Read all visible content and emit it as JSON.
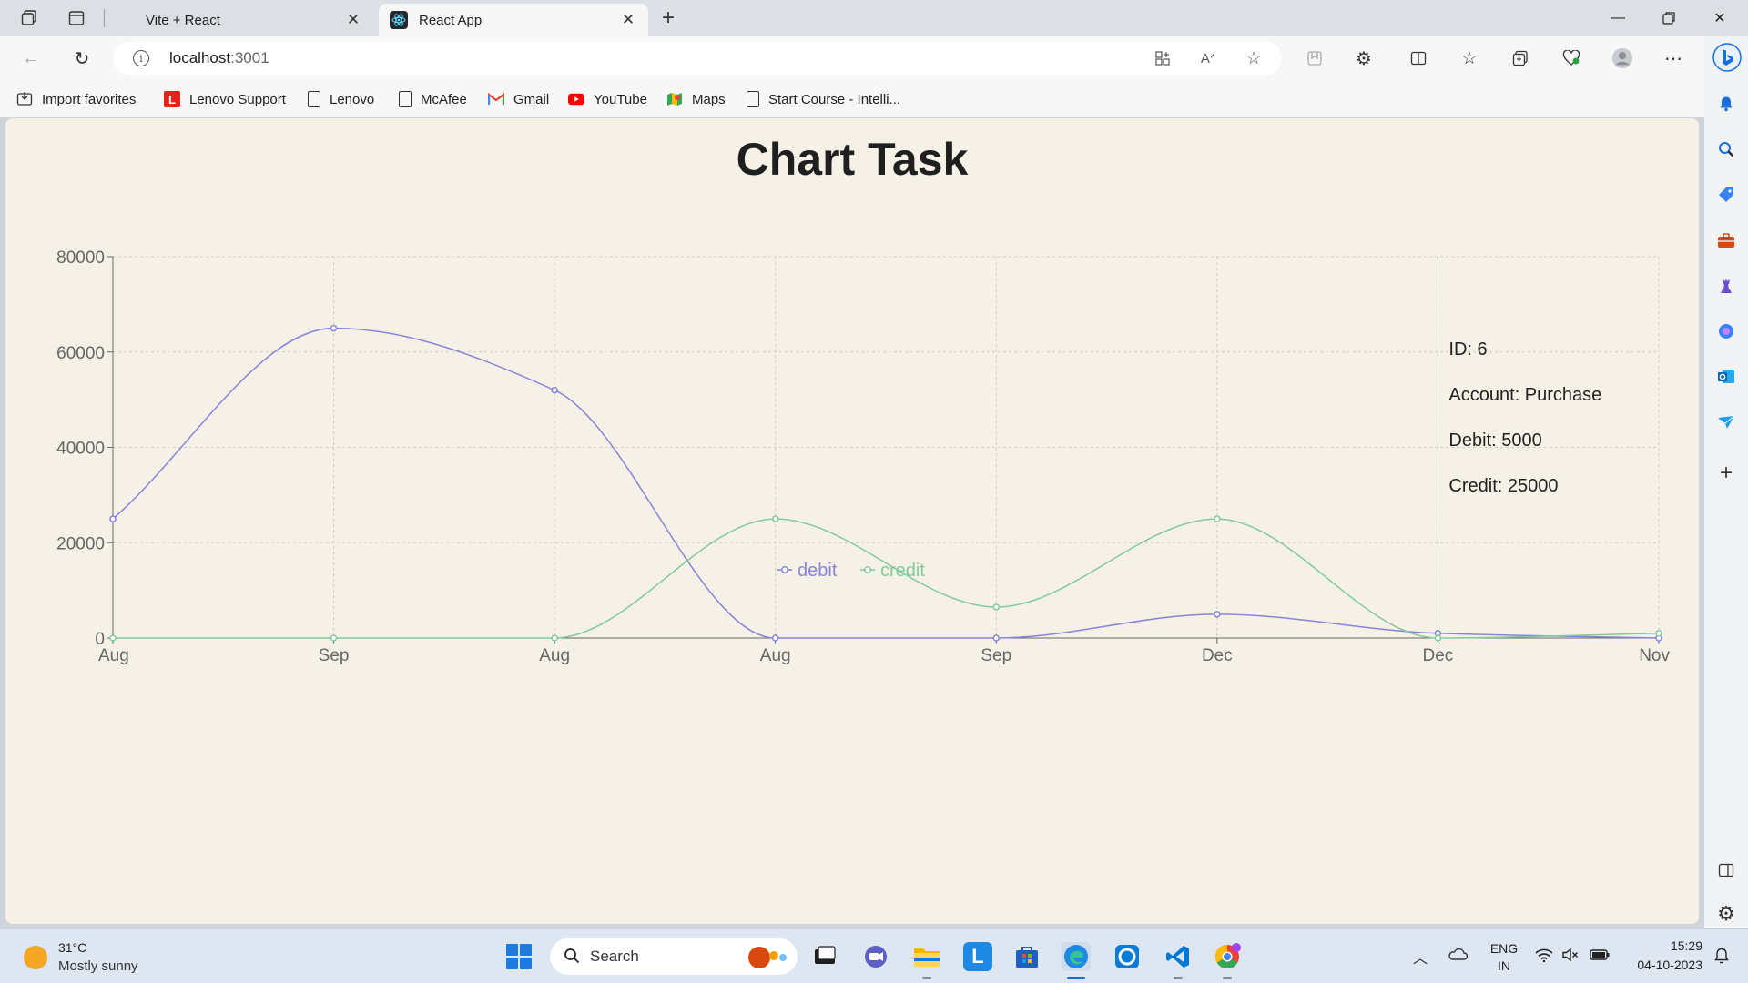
{
  "browser": {
    "tabs": [
      {
        "title": "Vite + React"
      },
      {
        "title": "React App",
        "active": true
      }
    ],
    "address": {
      "host": "localhost",
      "port": ":3001"
    },
    "favorites": [
      {
        "label": "Import favorites",
        "icon": "import-icon"
      },
      {
        "label": "Lenovo Support",
        "icon": "lenovo-l-icon"
      },
      {
        "label": "Lenovo",
        "icon": "document-icon"
      },
      {
        "label": "McAfee",
        "icon": "document-icon"
      },
      {
        "label": "Gmail",
        "icon": "gmail-icon"
      },
      {
        "label": "YouTube",
        "icon": "youtube-icon"
      },
      {
        "label": "Maps",
        "icon": "maps-icon"
      },
      {
        "label": "Start Course - Intelli...",
        "icon": "document-icon"
      }
    ]
  },
  "page": {
    "title": "Chart Task"
  },
  "chart_data": {
    "type": "line",
    "curve": "monotone",
    "categories": [
      "Aug",
      "Sep",
      "Aug",
      "Aug",
      "Sep",
      "Dec",
      "Dec",
      "Nov"
    ],
    "ylim": [
      0,
      80000
    ],
    "yticks": [
      0,
      20000,
      40000,
      60000,
      80000
    ],
    "grid": true,
    "legend_position": "bottom-center",
    "series": [
      {
        "name": "debit",
        "color": "#8884d8",
        "values": [
          25000,
          65000,
          52000,
          0,
          0,
          5000,
          1000,
          0
        ]
      },
      {
        "name": "credit",
        "color": "#82ca9d",
        "values": [
          0,
          0,
          0,
          25000,
          6500,
          25000,
          0,
          1000
        ]
      }
    ],
    "tooltip": {
      "category_index": 6,
      "lines": [
        "ID: 6",
        "Account: Purchase",
        "Debit: 5000",
        "Credit: 25000"
      ]
    }
  },
  "taskbar": {
    "weather": {
      "temp": "31°C",
      "desc": "Mostly sunny"
    },
    "search_label": "Search",
    "lang": [
      "ENG",
      "IN"
    ],
    "time": "15:29",
    "date": "04-10-2023"
  }
}
